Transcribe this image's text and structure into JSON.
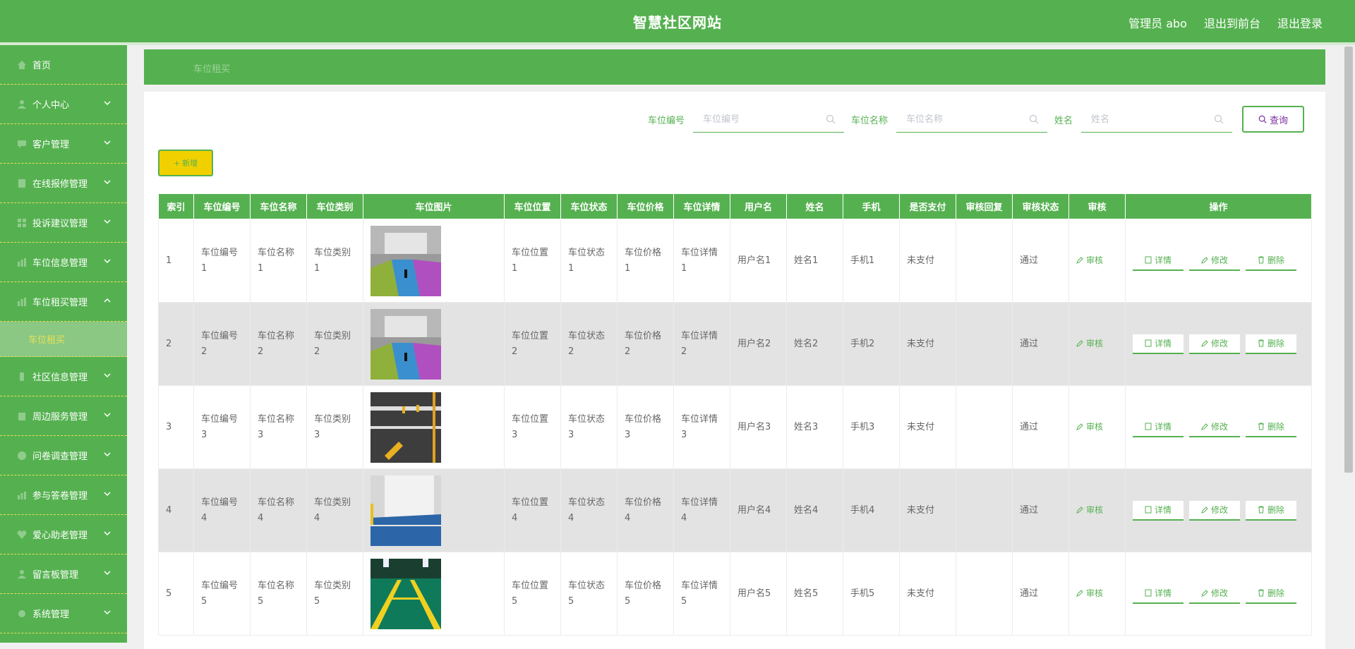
{
  "header": {
    "title": "智慧社区网站",
    "admin": "管理员 abo",
    "to_front": "退出到前台",
    "logout": "退出登录"
  },
  "sidebar": {
    "items": [
      {
        "label": "首页",
        "icon": "home-icon"
      },
      {
        "label": "个人中心",
        "icon": "user-icon"
      },
      {
        "label": "客户管理",
        "icon": "chat-icon"
      },
      {
        "label": "在线报修管理",
        "icon": "document-icon"
      },
      {
        "label": "投诉建议管理",
        "icon": "grid-icon"
      },
      {
        "label": "车位信息管理",
        "icon": "parking-icon"
      },
      {
        "label": "车位租买管理",
        "icon": "parking-icon"
      },
      {
        "label": "社区信息管理",
        "icon": "phone-icon"
      },
      {
        "label": "周边服务管理",
        "icon": "building-icon"
      },
      {
        "label": "问卷调查管理",
        "icon": "clock-icon"
      },
      {
        "label": "参与答卷管理",
        "icon": "chart-icon"
      },
      {
        "label": "爱心助老管理",
        "icon": "heart-icon"
      },
      {
        "label": "留言板管理",
        "icon": "user-icon"
      },
      {
        "label": "系统管理",
        "icon": "gear-icon"
      }
    ],
    "active_submenu": "车位租买"
  },
  "breadcrumb": "车位租买",
  "search": {
    "fields": [
      {
        "label": "车位编号",
        "placeholder": "车位编号"
      },
      {
        "label": "车位名称",
        "placeholder": "车位名称"
      },
      {
        "label": "姓名",
        "placeholder": "姓名"
      }
    ],
    "query_label": "查询"
  },
  "add_label": "新增",
  "table": {
    "headers": [
      "索引",
      "车位编号",
      "车位名称",
      "车位类别",
      "车位图片",
      "车位位置",
      "车位状态",
      "车位价格",
      "车位详情",
      "用户名",
      "姓名",
      "手机",
      "是否支付",
      "审核回复",
      "审核状态",
      "审核",
      "操作"
    ],
    "rows": [
      {
        "idx": "1",
        "code": "车位编号1",
        "name": "车位名称1",
        "type": "车位类别1",
        "img": "garage-colored",
        "pos": "车位位置1",
        "status": "车位状态1",
        "price": "车位价格1",
        "detail": "车位详情1",
        "user": "用户名1",
        "realname": "姓名1",
        "phone": "手机1",
        "paid": "未支付",
        "reply": "",
        "audit_status": "通过"
      },
      {
        "idx": "2",
        "code": "车位编号2",
        "name": "车位名称2",
        "type": "车位类别2",
        "img": "garage-colored",
        "pos": "车位位置2",
        "status": "车位状态2",
        "price": "车位价格2",
        "detail": "车位详情2",
        "user": "用户名2",
        "realname": "姓名2",
        "phone": "手机2",
        "paid": "未支付",
        "reply": "",
        "audit_status": "通过"
      },
      {
        "idx": "3",
        "code": "车位编号3",
        "name": "车位名称3",
        "type": "车位类别3",
        "img": "outdoor-lock",
        "pos": "车位位置3",
        "status": "车位状态3",
        "price": "车位价格3",
        "detail": "车位详情3",
        "user": "用户名3",
        "realname": "姓名3",
        "phone": "手机3",
        "paid": "未支付",
        "reply": "",
        "audit_status": "通过"
      },
      {
        "idx": "4",
        "code": "车位编号4",
        "name": "车位名称4",
        "type": "车位类别4",
        "img": "blue-floor",
        "pos": "车位位置4",
        "status": "车位状态4",
        "price": "车位价格4",
        "detail": "车位详情4",
        "user": "用户名4",
        "realname": "姓名4",
        "phone": "手机4",
        "paid": "未支付",
        "reply": "",
        "audit_status": "通过"
      },
      {
        "idx": "5",
        "code": "车位编号5",
        "name": "车位名称5",
        "type": "车位类别5",
        "img": "green-floor",
        "pos": "车位位置5",
        "status": "车位状态5",
        "price": "车位价格5",
        "detail": "车位详情5",
        "user": "用户名5",
        "realname": "姓名5",
        "phone": "手机5",
        "paid": "未支付",
        "reply": "",
        "audit_status": "通过"
      }
    ],
    "audit_label": "审核",
    "detail_label": "详情",
    "edit_label": "修改",
    "delete_label": "删除"
  },
  "colors": {
    "primary": "#55b150",
    "accent_yellow": "#e8e056",
    "add_button": "#f1d000"
  }
}
